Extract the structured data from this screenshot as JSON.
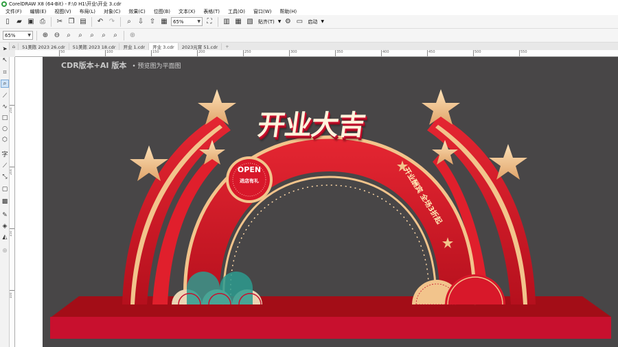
{
  "window": {
    "title": "CorelDRAW X8 (64-Bit) - F:\\0 H1\\开业\\开业 3.cdr"
  },
  "menu": [
    "文件(F)",
    "编辑(E)",
    "视图(V)",
    "布局(L)",
    "对象(C)",
    "效果(C)",
    "位图(B)",
    "文本(X)",
    "表格(T)",
    "工具(O)",
    "窗口(W)",
    "帮助(H)"
  ],
  "toolbar": {
    "zoom_value": "65%",
    "snap_label": "贴齐(T)",
    "launch_label": "启动"
  },
  "property_bar": {
    "zoom_value": "65%"
  },
  "doc_tabs": [
    "51美陈 2023 26.cdr",
    "51美陈 2023 18.cdr",
    "开业 1.cdr",
    "开业 3.cdr",
    "2023元宵 51.cdr"
  ],
  "active_tab": "开业 3.cdr",
  "hruler_labels": [
    "50",
    "100",
    "150",
    "200",
    "250",
    "300",
    "350",
    "400",
    "450",
    "500",
    "550"
  ],
  "vruler_labels": [
    "250",
    "200",
    "150",
    "100"
  ],
  "artwork": {
    "caption_main": "CDR版本+AI 版本",
    "caption_sub": "• 预览图为平面图",
    "title": "开业大吉",
    "slogan": "开业酬宾 全场3折起",
    "badge_main": "OPEN",
    "badge_sub": "进店有礼"
  },
  "colors": {
    "accent_red": "#d8182a",
    "dark_red": "#a30d17",
    "gold": "#f2c48c",
    "canvas_bg": "#484647"
  }
}
